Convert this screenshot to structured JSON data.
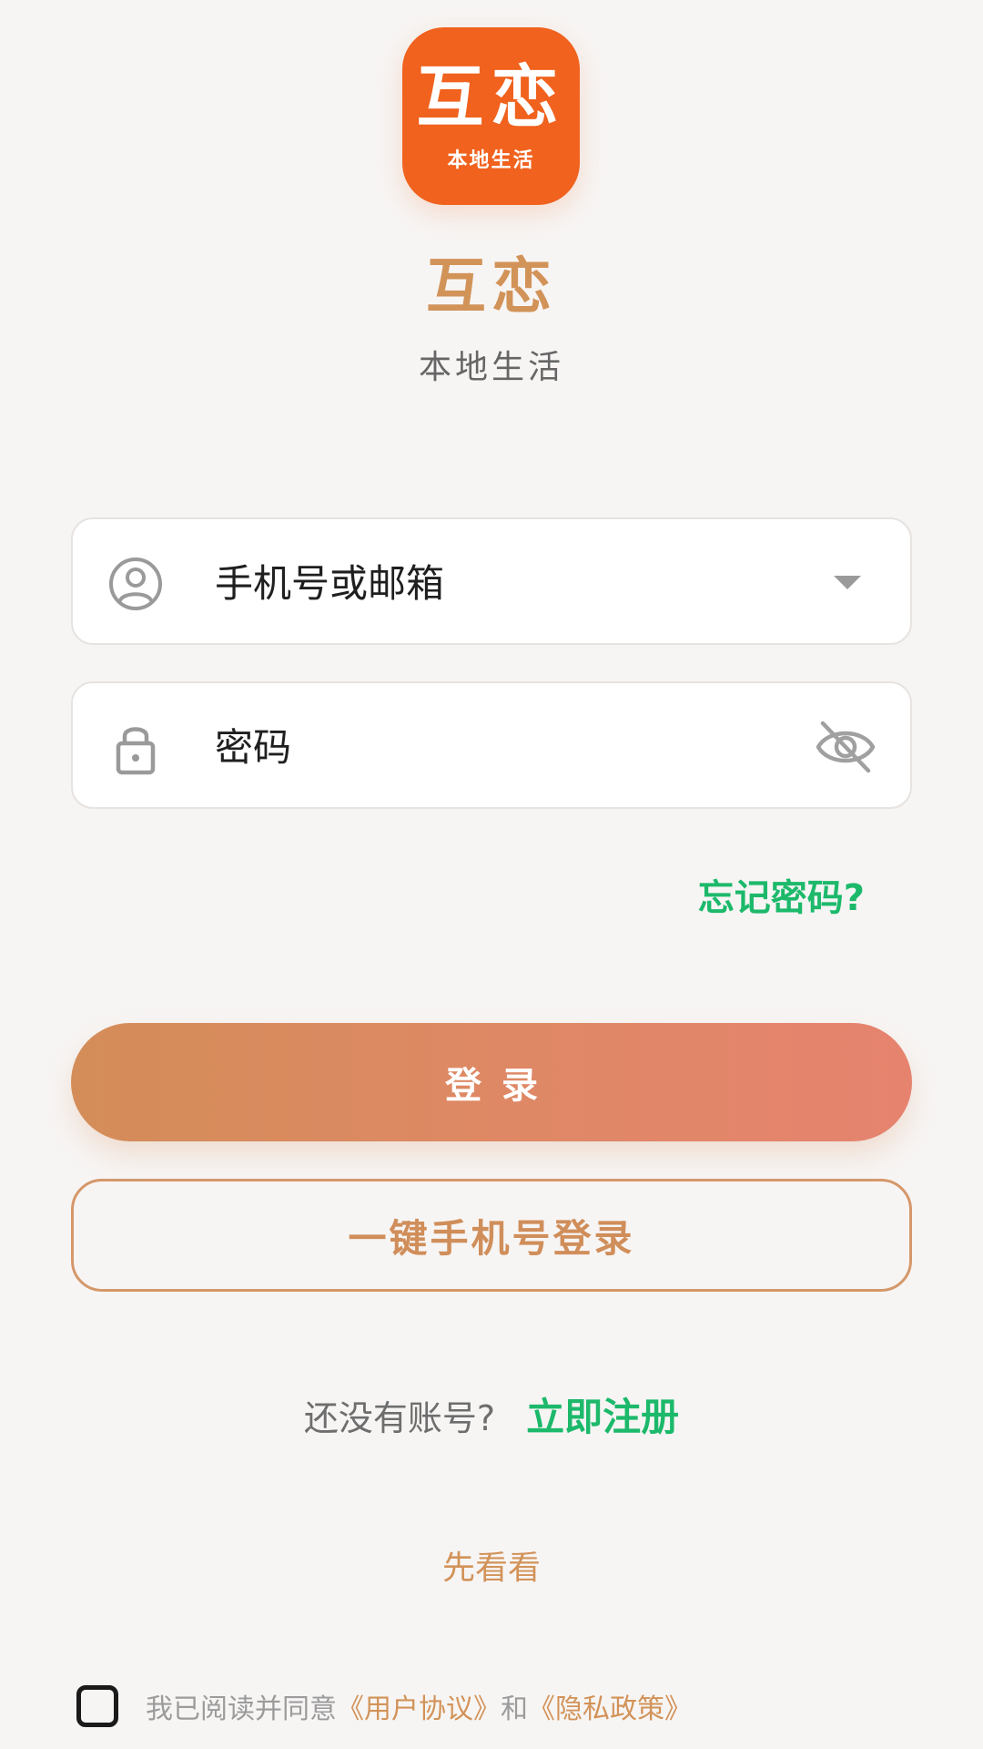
{
  "logo": {
    "main_text": "互恋",
    "sub_text": "本地生活"
  },
  "app": {
    "title": "互恋",
    "subtitle": "本地生活"
  },
  "form": {
    "account_placeholder": "手机号或邮箱",
    "password_placeholder": "密码",
    "forgot_label": "忘记密码?"
  },
  "buttons": {
    "login_label": "登录",
    "onekey_label": "一键手机号登录"
  },
  "register": {
    "question": "还没有账号?",
    "link_label": "立即注册"
  },
  "peek_label": "先看看",
  "agreement": {
    "prefix": "我已阅读并同意",
    "user_agreement": "《用户协议》",
    "conjunction": "和",
    "privacy_policy": "《隐私政策》",
    "checked": false
  },
  "colors": {
    "brand_orange": "#f0621e",
    "accent_gold": "#d29359",
    "link_green": "#1db96b",
    "background": "#f7f5f4"
  },
  "icons": {
    "account": "user-circle-icon",
    "password": "lock-icon",
    "dropdown": "caret-down-icon",
    "visibility": "eye-off-icon"
  }
}
